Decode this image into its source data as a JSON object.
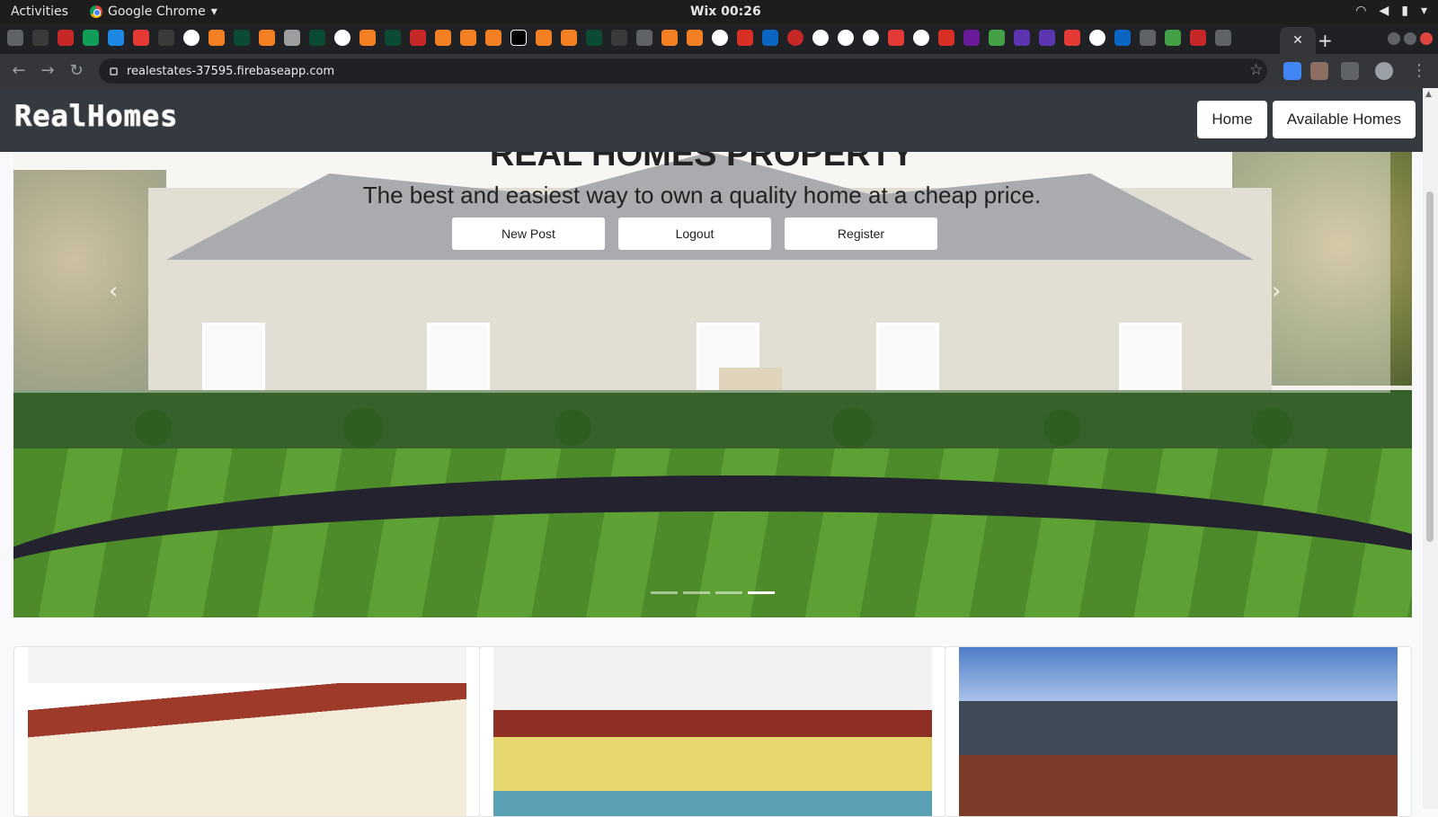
{
  "gnome": {
    "activities": "Activities",
    "app_name": "Google Chrome",
    "clock": "Wix 00:26"
  },
  "browser": {
    "url": "realestates-37595.firebaseapp.com",
    "active_tab_close": "✕",
    "new_tab": "+"
  },
  "site": {
    "logo": "RealHomes",
    "nav": {
      "home": "Home",
      "available": "Available Homes"
    }
  },
  "hero": {
    "title": "REAL HOMES PROPERTY",
    "subtitle": "The best and easiest way to own a quality home at a cheap price.",
    "buttons": {
      "new_post": "New Post",
      "logout": "Logout",
      "register": "Register"
    },
    "active_slide": 4,
    "slide_count": 4
  },
  "colors": {
    "navbar": "#343a40",
    "chrome_dark": "#202124"
  },
  "icons": [
    "chrome-icon",
    "wifi-icon",
    "volume-icon",
    "battery-icon",
    "back-icon",
    "forward-icon",
    "reload-icon",
    "lock-icon",
    "star-icon",
    "carousel-prev-icon",
    "carousel-next-icon"
  ]
}
